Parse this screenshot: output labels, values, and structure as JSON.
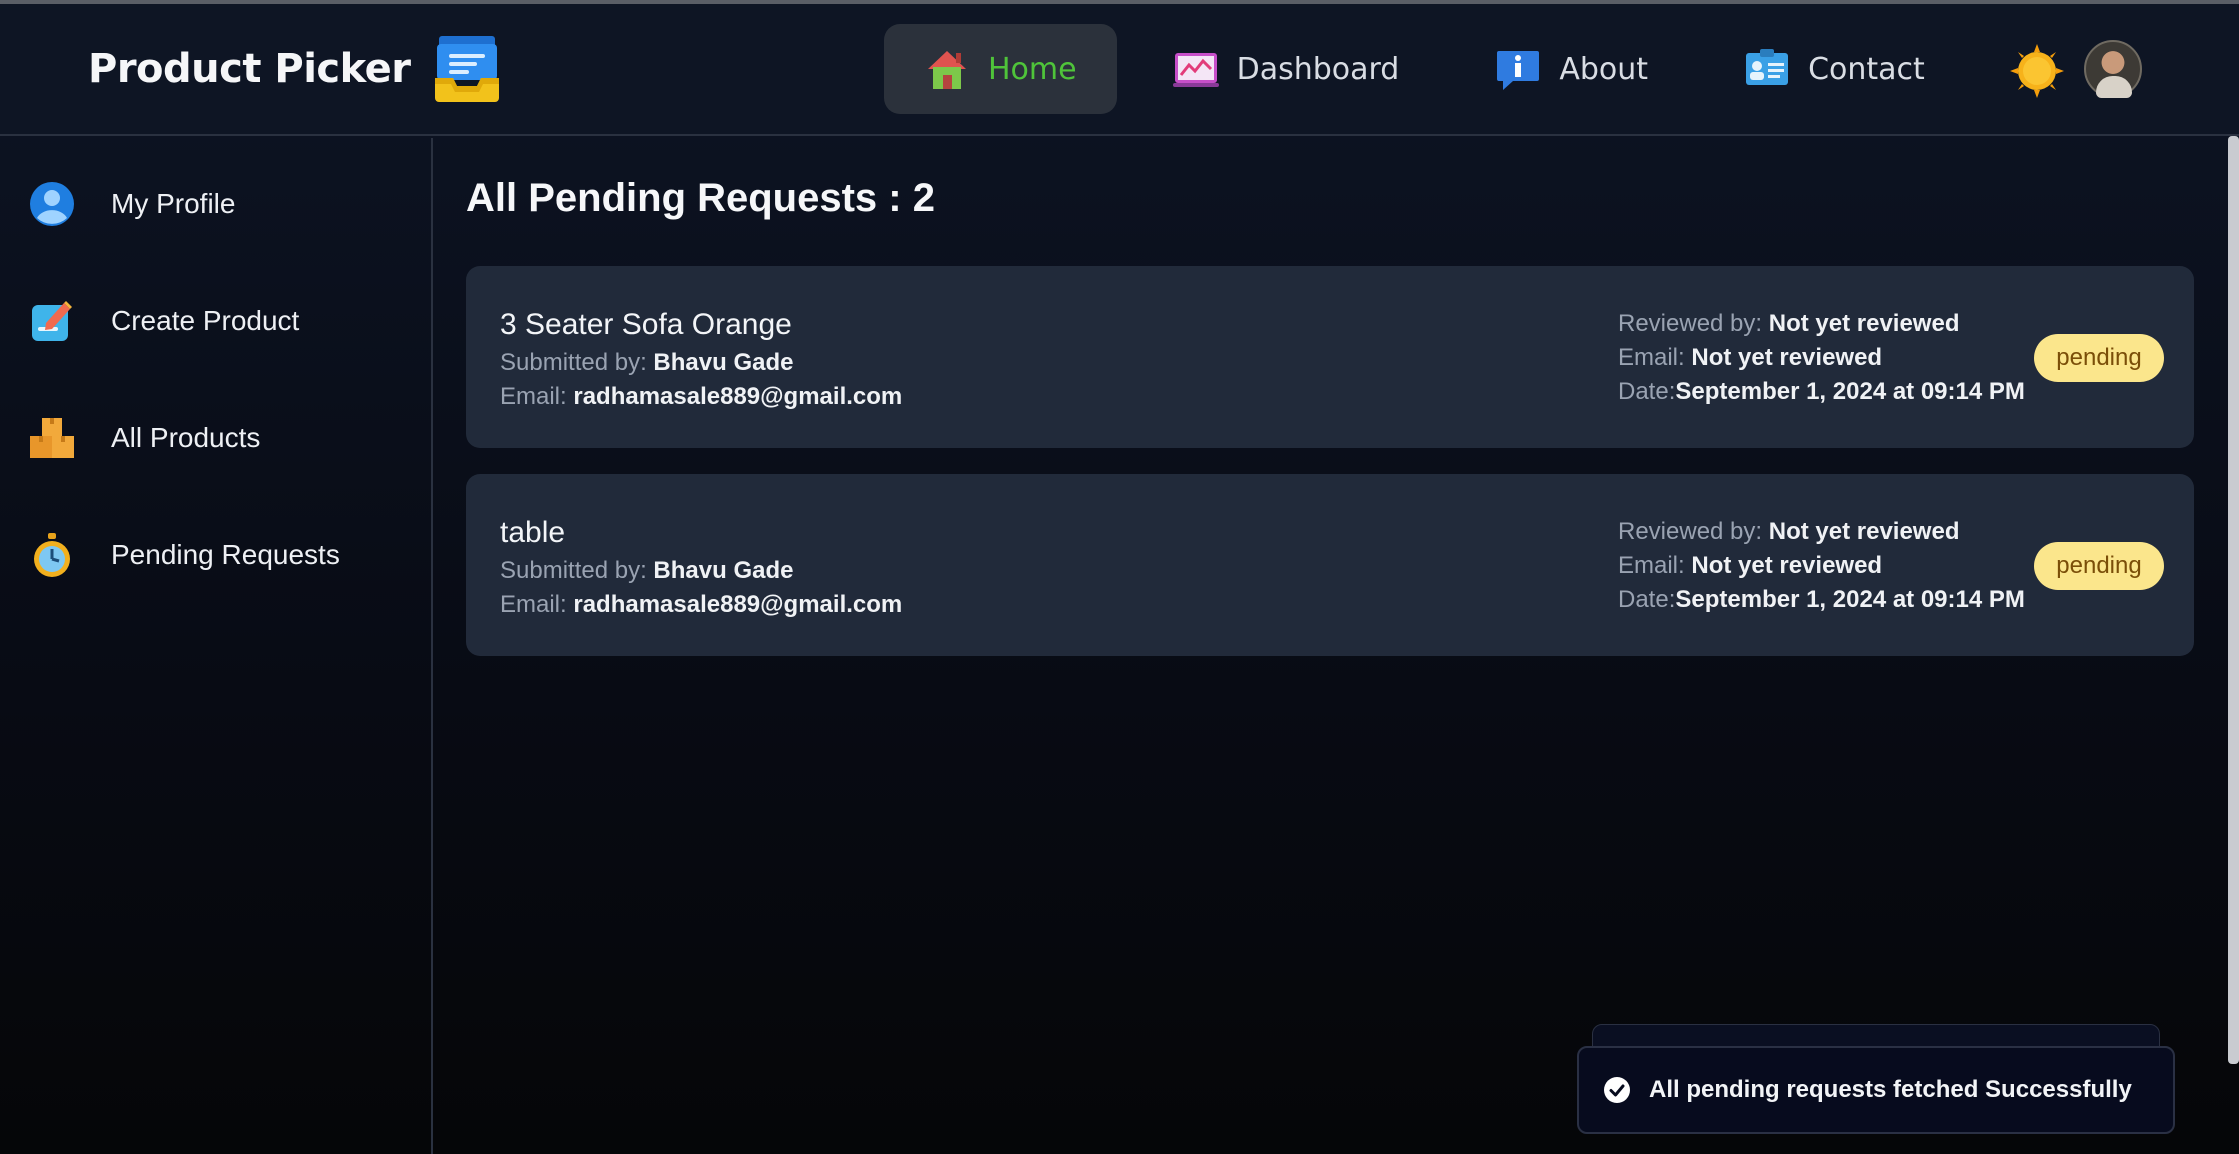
{
  "header": {
    "brand": "Product Picker",
    "nav": [
      {
        "label": "Home",
        "icon": "house-icon"
      },
      {
        "label": "Dashboard",
        "icon": "chart-icon"
      },
      {
        "label": "About",
        "icon": "info-icon"
      },
      {
        "label": "Contact",
        "icon": "contact-card-icon"
      }
    ],
    "active_nav": "Home",
    "theme_toggle_icon": "sun-icon",
    "accent_color": "#4fc43a"
  },
  "sidebar": {
    "items": [
      {
        "label": "My Profile",
        "icon": "profile-icon"
      },
      {
        "label": "Create Product",
        "icon": "create-icon"
      },
      {
        "label": "All Products",
        "icon": "boxes-icon"
      },
      {
        "label": "Pending Requests",
        "icon": "stopwatch-icon"
      }
    ]
  },
  "main": {
    "title": "All Pending Requests : 2",
    "requests": [
      {
        "product": "3 Seater Sofa Orange",
        "submitted_label": "Submitted by: ",
        "submitted_by": "Bhavu Gade",
        "email_label": "Email: ",
        "email": "radhamasale889@gmail.com",
        "reviewed_label": "Reviewed by: ",
        "reviewed_by": "Not yet reviewed",
        "review_email_label": "Email: ",
        "review_email": "Not yet reviewed",
        "date_label": "Date:",
        "date": "September 1, 2024 at 09:14 PM",
        "status": "pending"
      },
      {
        "product": "table",
        "submitted_label": "Submitted by: ",
        "submitted_by": "Bhavu Gade",
        "email_label": "Email: ",
        "email": "radhamasale889@gmail.com",
        "reviewed_label": "Reviewed by: ",
        "reviewed_by": "Not yet reviewed",
        "review_email_label": "Email: ",
        "review_email": "Not yet reviewed",
        "date_label": "Date:",
        "date": "September 1, 2024 at 09:14 PM",
        "status": "pending"
      }
    ]
  },
  "toast": {
    "message": "All pending requests fetched Successfully",
    "icon": "check-circle-icon"
  }
}
